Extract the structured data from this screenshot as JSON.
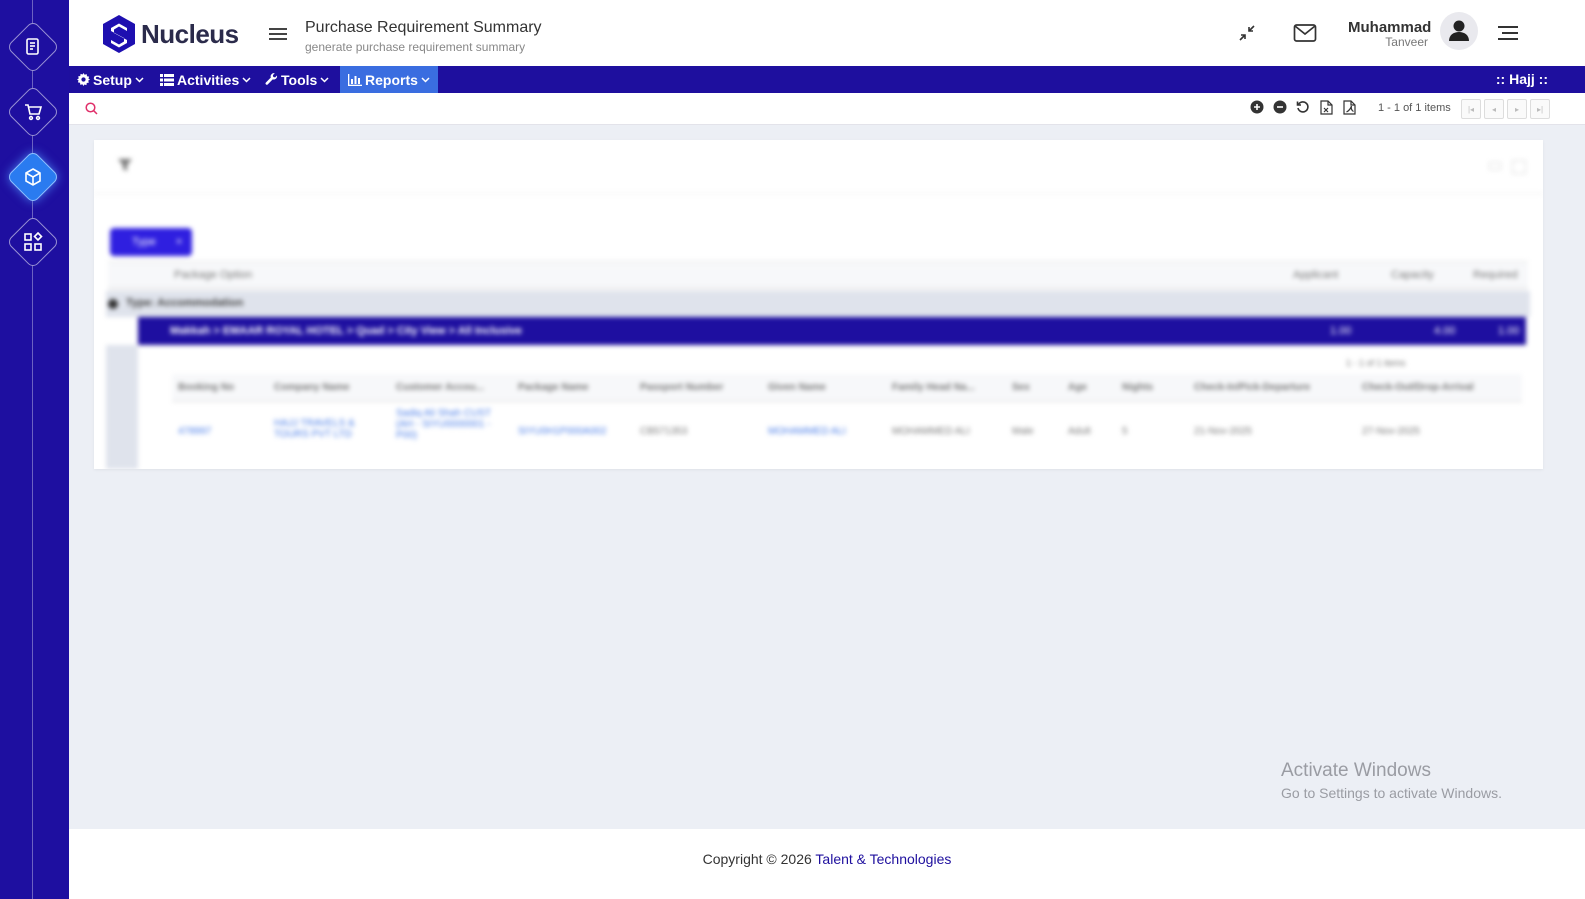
{
  "app": {
    "logo_text": "Nucleus"
  },
  "page": {
    "title": "Purchase Requirement Summary",
    "subtitle": "generate purchase requirement summary"
  },
  "user": {
    "first_name": "Muhammad",
    "last_name": "Tanveer"
  },
  "menu": {
    "items": [
      {
        "label": "Setup",
        "icon": "gear-icon"
      },
      {
        "label": "Activities",
        "icon": "list-icon"
      },
      {
        "label": "Tools",
        "icon": "wrench-icon"
      },
      {
        "label": "Reports",
        "icon": "bar-chart-icon",
        "active": true
      }
    ],
    "module": ":: Hajj ::"
  },
  "toolbar": {
    "pager_text": "1 - 1 of 1 items"
  },
  "grid": {
    "group_button": "Type",
    "master_headers": [
      "Package Option",
      "Applicant",
      "Capacity",
      "Required"
    ],
    "group_row": "Type: Accommodation",
    "detail_row": {
      "label": "Makkah > EMAAR ROYAL HOTEL > Quad > City View > All Inclusive",
      "values": [
        "1.00",
        "4.00",
        "1.00"
      ]
    },
    "sub_pager_text": "1 - 1 of 1 items",
    "detail_headers": [
      "Booking No",
      "Company Name",
      "Customer Accou...",
      "Package Name",
      "Passport Number",
      "Given Name",
      "Family Head Na...",
      "Sex",
      "Age",
      "Nights",
      "Check-In/Pick-Departure",
      "Check-Out/Drop-Arrival"
    ],
    "rows": [
      [
        "478997",
        "HAJJ TRAVELS & TOURS PVT LTD",
        "Sadiq Ali Shah CUST (AH - SIYU0000001 - P00)",
        "SIYU0H1P000A002",
        "CB571353",
        "MOHAMMED ALI",
        "MOHAMMED ALI",
        "Male",
        "Adult",
        "5",
        "21-Nov-2025",
        "27-Nov-2025"
      ]
    ]
  },
  "watermark": {
    "line1": "Activate Windows",
    "line2": "Go to Settings to activate Windows."
  },
  "footer": {
    "text": "Copyright © 2026 ",
    "link": "Talent & Technologies"
  }
}
